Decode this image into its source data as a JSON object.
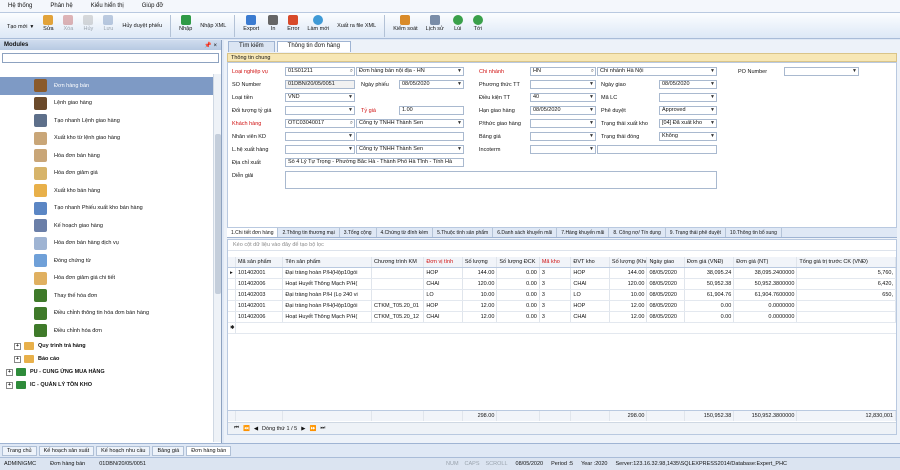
{
  "menu": [
    "Hệ thống",
    "Phân hệ",
    "Kiểu hiển thị",
    "Giúp đỡ"
  ],
  "toolbar": {
    "new": "Tạo mới",
    "edit": "Sửa",
    "delete": "Xóa",
    "cancel": "Hủy",
    "save": "Lưu",
    "cancel_approve": "Hủy duyệt phiếu",
    "import": "Nhập",
    "import_xml": "Nhập XML",
    "export": "Export",
    "print": "In",
    "error": "Error",
    "refresh": "Làm mới",
    "export_xml": "Xuất ra file XML",
    "audit": "Kiểm soát",
    "history": "Lịch sử",
    "back": "Lùi",
    "next": "Tới"
  },
  "sidebar": {
    "title": "Modules",
    "pin": "📌 ×",
    "items": [
      {
        "label": "Đơn hàng bán",
        "color": "#8a5a2b"
      },
      {
        "label": "Lệnh giao hàng",
        "color": "#6b4a2b"
      },
      {
        "label": "Tạo nhanh Lệnh giao hàng",
        "color": "#5d6f8a"
      },
      {
        "label": "Xuất kho từ lệnh giao hàng",
        "color": "#c9a678"
      },
      {
        "label": "Hóa đơn bán hàng",
        "color": "#c9a678"
      },
      {
        "label": "Hóa đơn giảm giá",
        "color": "#d7b46a"
      },
      {
        "label": "Xuất kho bán hàng",
        "color": "#e8b04a"
      },
      {
        "label": "Tạo nhanh Phiếu xuất kho bán hàng",
        "color": "#5b86c4"
      },
      {
        "label": "Kế hoạch giao hàng",
        "color": "#6b7fa8"
      },
      {
        "label": "Hóa đơn bán hàng dịch vụ",
        "color": "#9fb4d3"
      },
      {
        "label": "Đóng chứng từ",
        "color": "#6fa0d8"
      },
      {
        "label": "Hóa đơn giảm giá chi tiết",
        "color": "#e0b060"
      },
      {
        "label": "Thay thế hóa đơn",
        "color": "#3f7a2a"
      },
      {
        "label": "Điều chỉnh thông tin hóa đơn bán hàng",
        "color": "#3f7a2a"
      },
      {
        "label": "Điều chỉnh hóa đơn",
        "color": "#3f7a2a"
      }
    ],
    "groups": [
      {
        "label": "Quy trình trả hàng",
        "sign": "+"
      },
      {
        "label": "Báo cáo",
        "sign": "+"
      },
      {
        "label": "PU - CUNG ỨNG MUA HÀNG",
        "sign": "+"
      },
      {
        "label": "IC - QUẢN LÝ TỒN KHO",
        "sign": "+"
      }
    ]
  },
  "main_tabs": [
    "Tìm kiếm",
    "Thông tin đơn hàng"
  ],
  "section_title": "Thông tin chung",
  "form": {
    "loai_nghiep_vu": {
      "label": "Loại nghiệp vụ",
      "code": "01S01211",
      "name": "Đơn hàng bán nội địa - HN"
    },
    "so_number": {
      "label": "SO Number",
      "value": "01DBN/20/05/0051"
    },
    "ngay_phieu": {
      "label": "Ngày phiếu",
      "value": "08/05/2020"
    },
    "loai_tien": {
      "label": "Loại tiền",
      "value": "VND"
    },
    "doi_tuong_ty_gia": {
      "label": "Đối tượng tỷ giá"
    },
    "ty_gia": {
      "label": "Tỷ giá",
      "value": "1.00"
    },
    "khach_hang": {
      "label": "Khách hàng",
      "code": "OTC03040017",
      "name": "Công ty TNHH Thành Sen"
    },
    "nhan_vien_kd": {
      "label": "Nhân viên KD"
    },
    "lhe_xuat_hang": {
      "label": "L.hệ xuất hàng",
      "name": "Công ty TNHH Thành Sen"
    },
    "dia_chi_xuat": {
      "label": "Địa chỉ xuất",
      "value": "Số 4 Lý Tự Trọng - Phường Bắc Hà - Thành Phố  Hà Tĩnh - Tỉnh Hà"
    },
    "dien_giai": {
      "label": "Diễn giải"
    },
    "chi_nhanh": {
      "label": "Chi nhánh",
      "code": "HN",
      "name": "Chi nhánh Hà Nội"
    },
    "phuong_thuc_tt": {
      "label": "Phương thức TT",
      "value": ""
    },
    "dieu_kien_tt": {
      "label": "Điều kiện TT",
      "value": "40"
    },
    "han_giao_hang": {
      "label": "Hạn giao hàng",
      "value": "08/05/2020"
    },
    "pthuc_giao_hang": {
      "label": "P/thức giao hàng"
    },
    "bang_gia": {
      "label": "Bảng giá"
    },
    "incoterm": {
      "label": "Incoterm"
    },
    "ngay_giao": {
      "label": "Ngày giao",
      "value": "08/05/2020"
    },
    "ma_lc": {
      "label": "Mã LC"
    },
    "phe_duyet": {
      "label": "Phê duyệt",
      "value": "Approved"
    },
    "trang_thai_xuat_kho": {
      "label": "Trạng thái xuất kho",
      "value": "[04] Đã xuất kho"
    },
    "trang_thai_dong": {
      "label": "Trạng thái đóng",
      "value": "Không"
    },
    "po_number": {
      "label": "PO Number"
    }
  },
  "detail_tabs": [
    "1.Chi tiết đơn hàng",
    "2.Thông tin thương mại",
    "3.Tổng cộng",
    "4.Chứng từ đính kèm",
    "5.Thuộc tính sản phẩm",
    "6.Danh sách khuyến mãi",
    "7.Hàng khuyến mãi",
    "8. Công nợ/ Tín dụng",
    "9. Trạng thái phê duyệt",
    "10.Thông tin bổ sung"
  ],
  "grid": {
    "group_hint": "Kéo cột dữ liệu vào đây để tạo bộ lọc",
    "columns": [
      "Mã sản phẩm",
      "Tên sản phẩm",
      "Chương trình KM",
      "Đơn vị tính",
      "Số lượng",
      "Số lượng ĐCK",
      "Mã kho",
      "ĐVT kho",
      "Số lượng (Kho)",
      "Ngày giao",
      "Đơn giá (VNĐ)",
      "Đơn giá (NT)",
      "Tổng giá trị trước CK (VNĐ)"
    ],
    "red_columns": [
      "Đơn vị tính",
      "Mã kho"
    ],
    "rows": [
      [
        "101402001",
        "Đại tràng hoàn P/H(Hộp10gói",
        "",
        "HOP",
        "144.00",
        "0.00",
        "3",
        "HOP",
        "144.00",
        "08/05/2020",
        "38,095.24",
        "38,095.2400000",
        "5,760,"
      ],
      [
        "101402006",
        "Hoạt Huyết Thông Mạch P/H(",
        "",
        "CHAI",
        "120.00",
        "0.00",
        "3",
        "CHAI",
        "120.00",
        "08/05/2020",
        "50,952.38",
        "50,952.3800000",
        "6,420,"
      ],
      [
        "101402003",
        "Đại tràng hoàn P/H (Lọ 240 vi",
        "",
        "LO",
        "10.00",
        "0.00",
        "3",
        "LO",
        "10.00",
        "08/05/2020",
        "61,904.76",
        "61,904.7600000",
        "650,"
      ],
      [
        "101402001",
        "Đại tràng hoàn P/H(Hộp10gói",
        "CTKM_T05.20_01",
        "HOP",
        "12.00",
        "0.00",
        "3",
        "HOP",
        "12.00",
        "08/05/2020",
        "0.00",
        "0.0000000",
        ""
      ],
      [
        "101402006",
        "Hoạt Huyết Thông Mạch P/H(",
        "CTKM_T05.20_12",
        "CHAI",
        "12.00",
        "0.00",
        "3",
        "CHAI",
        "12.00",
        "08/05/2020",
        "0.00",
        "0.0000000",
        ""
      ]
    ],
    "totals": {
      "so_luong": "298.00",
      "so_luong_kho": "298.00",
      "don_gia": "150,952.38",
      "don_gia_nt": "150,952.3800000",
      "tong": "12,830,001"
    },
    "pager": "Dòng thứ 1 / 5"
  },
  "bottom_tabs": [
    "Trang chủ",
    "Kế hoạch sản xuất",
    "Kế hoạch nhu cầu",
    "Bảng giá",
    "Đơn hàng bán"
  ],
  "status": {
    "user": "ADMIN\\GMC",
    "form": "Đơn hàng bán",
    "doc": "01DBN/20/05/0051",
    "num": "NUM",
    "caps": "CAPS",
    "scroll": "SCROLL",
    "date": "08/05/2020",
    "period": "Period :5",
    "year": "Year :2020",
    "server": "Server:123.16.32.98,1435\\SQLEXPRESS2014/Database:Expert_PHC"
  }
}
